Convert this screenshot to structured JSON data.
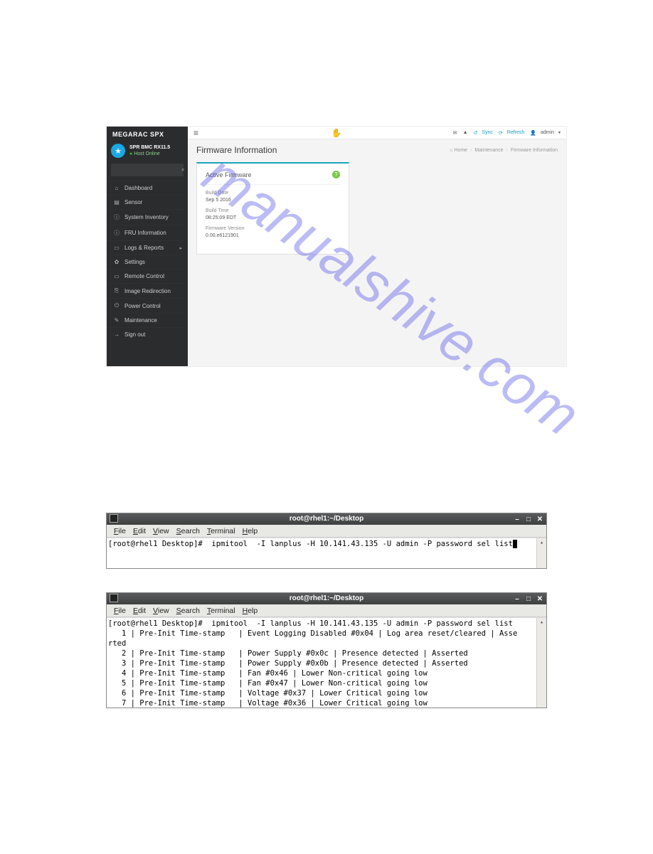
{
  "watermark": "manualshive.com",
  "bmc": {
    "brand": "MEGARAC SPX",
    "hostName": "SPR BMC RX11.5",
    "hostStatus": "Host Online",
    "search": {
      "placeholder": ""
    },
    "menu": [
      {
        "icon": "⌂",
        "label": "Dashboard",
        "caret": false
      },
      {
        "icon": "▤",
        "label": "Sensor",
        "caret": false
      },
      {
        "icon": "ⓘ",
        "label": "System Inventory",
        "caret": false
      },
      {
        "icon": "ⓘ",
        "label": "FRU Information",
        "caret": false
      },
      {
        "icon": "▭",
        "label": "Logs & Reports",
        "caret": true
      },
      {
        "icon": "✿",
        "label": "Settings",
        "caret": false
      },
      {
        "icon": "▭",
        "label": "Remote Control",
        "caret": false
      },
      {
        "icon": "⎘",
        "label": "Image Redirection",
        "caret": false
      },
      {
        "icon": "⏻",
        "label": "Power Control",
        "caret": false
      },
      {
        "icon": "✎",
        "label": "Maintenance",
        "caret": false
      },
      {
        "icon": "→",
        "label": "Sign out",
        "caret": false
      }
    ],
    "topbar": {
      "sync": "Sync",
      "refresh": "Refresh",
      "user": "admin"
    },
    "page": {
      "title": "Firmware Information",
      "crumbHome": "Home",
      "crumbMid": "Maintenance",
      "crumbLeaf": "Firmware Information"
    },
    "card": {
      "title": "Active Firmware",
      "fields": [
        {
          "label": "Build Date",
          "value": "Sep 5 2016"
        },
        {
          "label": "Build Time",
          "value": "08:25:09 EDT"
        },
        {
          "label": "Firmware Version",
          "value": "0.00.e6121901"
        }
      ]
    }
  },
  "term1": {
    "title": "root@rhel1:~/Desktop",
    "menu": [
      "File",
      "Edit",
      "View",
      "Search",
      "Terminal",
      "Help"
    ],
    "lines": [
      "[root@rhel1 Desktop]#  ipmitool  -I lanplus -H 10.141.43.135 -U admin -P password sel list"
    ]
  },
  "term2": {
    "title": "root@rhel1:~/Desktop",
    "menu": [
      "File",
      "Edit",
      "View",
      "Search",
      "Terminal",
      "Help"
    ],
    "lines": [
      "[root@rhel1 Desktop]#  ipmitool  -I lanplus -H 10.141.43.135 -U admin -P password sel list",
      "   1 | Pre-Init Time-stamp   | Event Logging Disabled #0x04 | Log area reset/cleared | Asse",
      "rted",
      "   2 | Pre-Init Time-stamp   | Power Supply #0x0c | Presence detected | Asserted",
      "   3 | Pre-Init Time-stamp   | Power Supply #0x0b | Presence detected | Asserted",
      "   4 | Pre-Init Time-stamp   | Fan #0x46 | Lower Non-critical going low",
      "   5 | Pre-Init Time-stamp   | Fan #0x47 | Lower Non-critical going low",
      "   6 | Pre-Init Time-stamp   | Voltage #0x37 | Lower Critical going low",
      "   7 | Pre-Init Time-stamp   | Voltage #0x36 | Lower Critical going low"
    ]
  }
}
